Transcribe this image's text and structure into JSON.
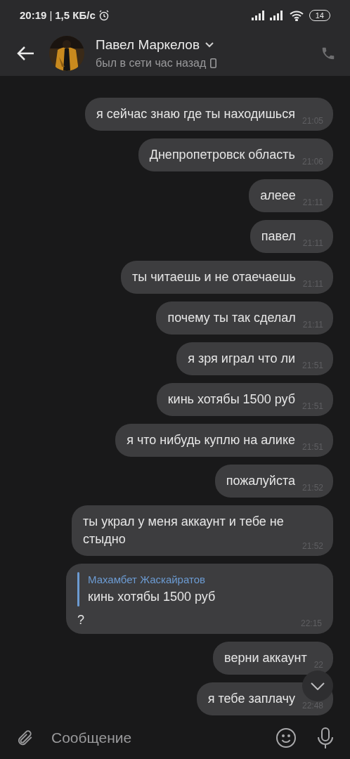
{
  "status_bar": {
    "time": "20:19",
    "divider": "|",
    "speed": "1,5 КБ/с",
    "battery": "14"
  },
  "header": {
    "name": "Павел Маркелов",
    "status": "был в сети час назад"
  },
  "messages": [
    {
      "kind": "text",
      "text": "я сейчас знаю где ты находишься",
      "time": "21:05"
    },
    {
      "kind": "text",
      "text": "Днепропетровск область",
      "time": "21:06"
    },
    {
      "kind": "text",
      "text": "алеее",
      "time": "21:11"
    },
    {
      "kind": "text",
      "text": "павел",
      "time": "21:11"
    },
    {
      "kind": "text",
      "text": "ты читаешь и не отаечаешь",
      "time": "21:11"
    },
    {
      "kind": "text",
      "text": "почему ты так сделал",
      "time": "21:11"
    },
    {
      "kind": "text",
      "text": "я зря играл что ли",
      "time": "21:51"
    },
    {
      "kind": "text",
      "text": "кинь хотябы 1500 руб",
      "time": "21:51"
    },
    {
      "kind": "text",
      "text": "я что нибудь куплю на алике",
      "time": "21:51"
    },
    {
      "kind": "text",
      "text": "пожалуйста",
      "time": "21:52"
    },
    {
      "kind": "text",
      "text": "ты украл у меня аккаунт и тебе не стыдно",
      "time": "21:52"
    },
    {
      "kind": "reply",
      "reply_author": "Махамбет Жаскайратов",
      "reply_text": "кинь хотябы 1500 руб",
      "text": "?",
      "time": "22:15"
    },
    {
      "kind": "text",
      "text": "верни аккаунт",
      "time": "22"
    },
    {
      "kind": "text",
      "text": "я тебе заплачу",
      "time": "22:48"
    }
  ],
  "composer": {
    "placeholder": "Сообщение"
  }
}
